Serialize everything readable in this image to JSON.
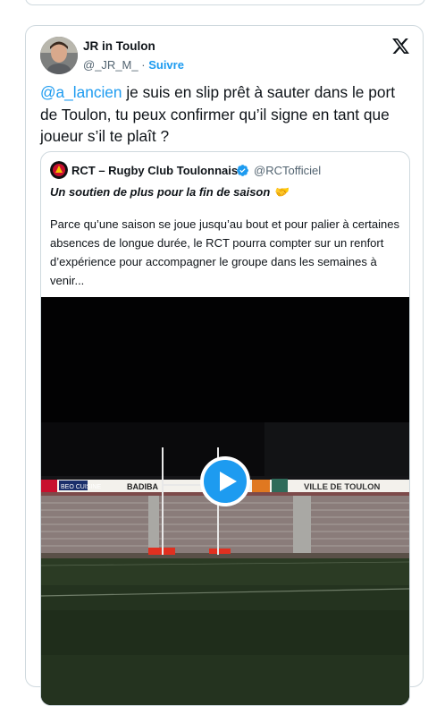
{
  "tweet": {
    "author_name": "JR in Toulon",
    "handle": "@_JR_M_",
    "separator": "·",
    "follow_label": "Suivre",
    "mention": "@a_lancien",
    "text": " je suis en slip prêt à sauter dans le port de Toulon, tu peux confirmer qu’il signe en tant que joueur s’il te plaît ?"
  },
  "quote": {
    "account_name": "RCT – Rugby Club Toulonnais",
    "handle": "@RCTofficiel",
    "subtitle": "Un soutien de plus pour la fin de saison",
    "subtitle_emoji": "🤝",
    "body": "Parce qu’une saison se joue jusqu’au bout et pour palier à certaines absences de longue durée, le RCT pourra compter sur un renfort d’expérience pour accompagner le groupe dans les semaines à venir...",
    "media": {
      "stadium_banner": "VILLE DE TOULON",
      "sponsor_1": "BADIBA",
      "sponsor_2": "BEO CUISINE",
      "play_icon": "play-icon"
    }
  },
  "icons": {
    "x_logo": "x-logo-icon",
    "verified": "verified-badge-icon"
  },
  "colors": {
    "accent": "#1d9bf0",
    "text": "#0f1419",
    "muted": "#536471",
    "border": "#cfd9de"
  }
}
